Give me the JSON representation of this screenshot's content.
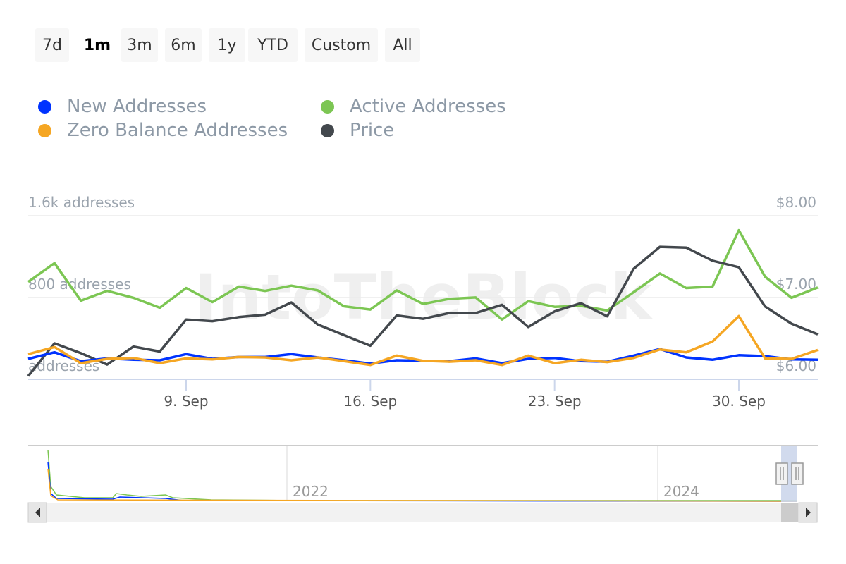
{
  "range_selector": {
    "buttons": [
      "7d",
      "1m",
      "3m",
      "6m",
      "1y",
      "YTD",
      "Custom",
      "All"
    ],
    "selected": "1m"
  },
  "legend": [
    {
      "name": "New Addresses",
      "color": "#0033ff"
    },
    {
      "name": "Active Addresses",
      "color": "#7cc653"
    },
    {
      "name": "Zero Balance Addresses",
      "color": "#f5a623"
    },
    {
      "name": "Price",
      "color": "#43484d"
    }
  ],
  "watermark": "IntoTheBlock",
  "chart_data": {
    "type": "line",
    "x": [
      "2024-09-03",
      "2024-09-04",
      "2024-09-05",
      "2024-09-06",
      "2024-09-07",
      "2024-09-08",
      "2024-09-09",
      "2024-09-10",
      "2024-09-11",
      "2024-09-12",
      "2024-09-13",
      "2024-09-14",
      "2024-09-15",
      "2024-09-16",
      "2024-09-17",
      "2024-09-18",
      "2024-09-19",
      "2024-09-20",
      "2024-09-21",
      "2024-09-22",
      "2024-09-23",
      "2024-09-24",
      "2024-09-25",
      "2024-09-26",
      "2024-09-27",
      "2024-09-28",
      "2024-09-29",
      "2024-09-30",
      "2024-10-01",
      "2024-10-02",
      "2024-10-03"
    ],
    "x_ticks": [
      "9. Sep",
      "16. Sep",
      "23. Sep",
      "30. Sep"
    ],
    "y_left": {
      "ticks": [
        "addresses",
        "800 addresses",
        "1.6k addresses"
      ],
      "range": [
        0,
        1600
      ]
    },
    "y_right": {
      "ticks": [
        "$6.00",
        "$7.00",
        "$8.00"
      ],
      "range": [
        6,
        8
      ]
    },
    "grid": true,
    "legend_position": "top-left",
    "series": [
      {
        "name": "New Addresses",
        "axis": "left",
        "color": "#0033ff",
        "values": [
          200,
          264,
          177,
          204,
          191,
          186,
          246,
          200,
          218,
          218,
          246,
          214,
          186,
          154,
          186,
          181,
          177,
          204,
          158,
          200,
          209,
          177,
          172,
          232,
          296,
          214,
          191,
          236,
          227,
          195,
          191
        ]
      },
      {
        "name": "Active Addresses",
        "axis": "left",
        "color": "#7cc653",
        "values": [
          953,
          1136,
          769,
          865,
          797,
          700,
          893,
          755,
          907,
          865,
          916,
          870,
          714,
          682,
          870,
          737,
          787,
          801,
          585,
          764,
          709,
          718,
          673,
          852,
          1035,
          893,
          907,
          1458,
          1003,
          797,
          898
        ]
      },
      {
        "name": "Zero Balance Addresses",
        "axis": "left",
        "color": "#f5a623",
        "values": [
          246,
          315,
          158,
          200,
          209,
          158,
          204,
          195,
          218,
          214,
          186,
          214,
          177,
          140,
          232,
          181,
          172,
          186,
          140,
          232,
          158,
          191,
          168,
          209,
          292,
          264,
          370,
          618,
          204,
          200,
          287
        ]
      },
      {
        "name": "Price",
        "axis": "right",
        "color": "#43484d",
        "values": [
          6.04,
          6.44,
          6.32,
          6.18,
          6.4,
          6.34,
          6.73,
          6.71,
          6.76,
          6.79,
          6.94,
          6.67,
          6.54,
          6.41,
          6.78,
          6.74,
          6.81,
          6.81,
          6.91,
          6.64,
          6.83,
          6.93,
          6.77,
          7.35,
          7.62,
          7.61,
          7.45,
          7.37,
          6.89,
          6.68,
          6.55
        ]
      }
    ],
    "navigator": {
      "x_ticks": [
        "2022",
        "2024"
      ],
      "selected_range": "last 1 month"
    }
  }
}
